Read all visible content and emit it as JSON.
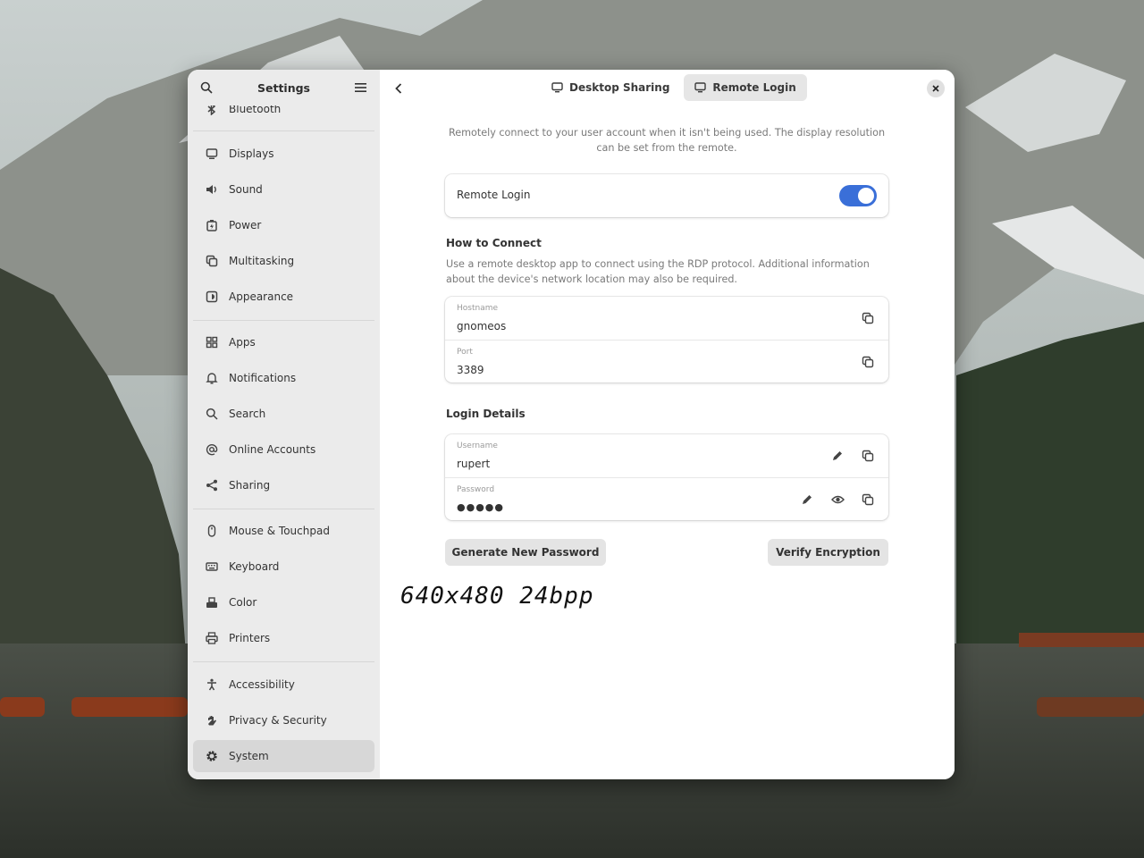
{
  "sidebar": {
    "title": "Settings",
    "partial_item": "Bluetooth",
    "items": [
      {
        "label": "Displays",
        "icon": "display-icon"
      },
      {
        "label": "Sound",
        "icon": "speaker-icon"
      },
      {
        "label": "Power",
        "icon": "battery-icon"
      },
      {
        "label": "Multitasking",
        "icon": "multitasking-icon"
      },
      {
        "label": "Appearance",
        "icon": "appearance-icon"
      },
      {
        "label": "Apps",
        "icon": "apps-grid-icon"
      },
      {
        "label": "Notifications",
        "icon": "bell-icon"
      },
      {
        "label": "Search",
        "icon": "search-icon"
      },
      {
        "label": "Online Accounts",
        "icon": "at-sign-icon"
      },
      {
        "label": "Sharing",
        "icon": "share-icon"
      },
      {
        "label": "Mouse & Touchpad",
        "icon": "mouse-icon"
      },
      {
        "label": "Keyboard",
        "icon": "keyboard-icon"
      },
      {
        "label": "Color",
        "icon": "color-icon"
      },
      {
        "label": "Printers",
        "icon": "printer-icon"
      },
      {
        "label": "Accessibility",
        "icon": "accessibility-icon"
      },
      {
        "label": "Privacy & Security",
        "icon": "hand-icon"
      },
      {
        "label": "System",
        "icon": "gear-icon"
      }
    ],
    "selected": "System"
  },
  "tabs": [
    {
      "label": "Desktop Sharing",
      "icon": "monitor-icon",
      "active": false
    },
    {
      "label": "Remote Login",
      "icon": "monitor-icon",
      "active": true
    }
  ],
  "intro": "Remotely connect to your user account when it isn't being used. The display resolution can be set from the remote.",
  "remote_login": {
    "label": "Remote Login",
    "enabled": true
  },
  "how_to_connect": {
    "title": "How to Connect",
    "description": "Use a remote desktop app to connect using the RDP protocol. Additional information about the device's network location may also be required.",
    "hostname_label": "Hostname",
    "hostname": "gnomeos",
    "port_label": "Port",
    "port": "3389"
  },
  "login_details": {
    "title": "Login Details",
    "username_label": "Username",
    "username": "rupert",
    "password_label": "Password",
    "password": "●●●●●"
  },
  "buttons": {
    "generate": "Generate New Password",
    "verify": "Verify Encryption"
  },
  "overlay": "640x480 24bpp",
  "colors": {
    "accent": "#3a6fd8",
    "sidebar_bg": "#ebebeb",
    "selected_bg": "#d7d7d7"
  }
}
